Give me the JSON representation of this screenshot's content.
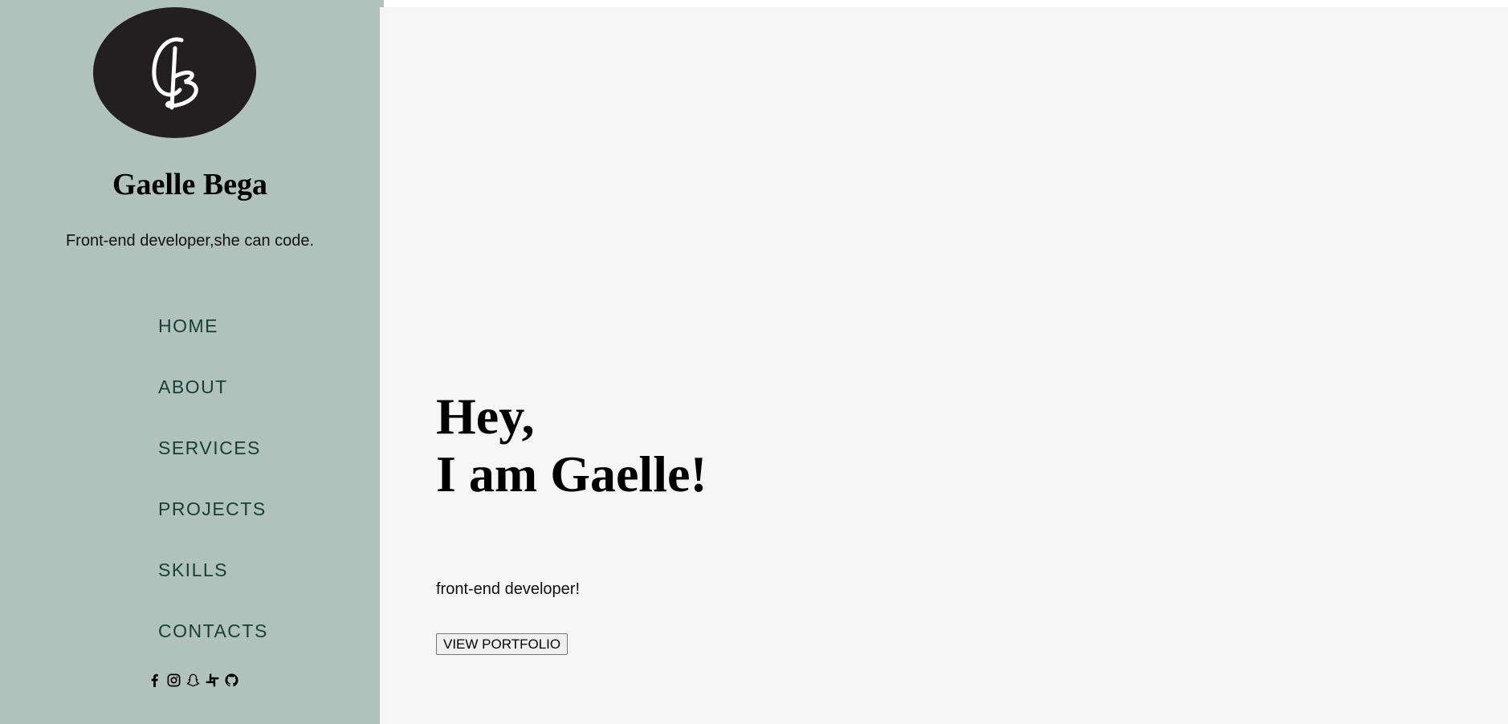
{
  "sidebar": {
    "logo_icon": "gb-monogram-logo",
    "name": "Gaelle Bega",
    "tagline": "Front-end developer,she can code.",
    "nav": [
      {
        "label": "HOME"
      },
      {
        "label": "ABOUT"
      },
      {
        "label": "SERVICES"
      },
      {
        "label": "PROJECTS"
      },
      {
        "label": "SKILLS"
      },
      {
        "label": "CONTACTS"
      }
    ],
    "socials": [
      "facebook-icon",
      "instagram-icon",
      "snapchat-icon",
      "slack-icon",
      "github-icon"
    ]
  },
  "hero": {
    "line1": "Hey,",
    "line2": "I am Gaelle!",
    "subtitle": "front-end developer!",
    "button_label": "VIEW PORTFOLIO"
  },
  "colors": {
    "sidebar_bg": "#b1c2bc",
    "logo_bg": "#231f20",
    "nav_text": "#163f35",
    "main_bg": "#f6f6f6"
  }
}
